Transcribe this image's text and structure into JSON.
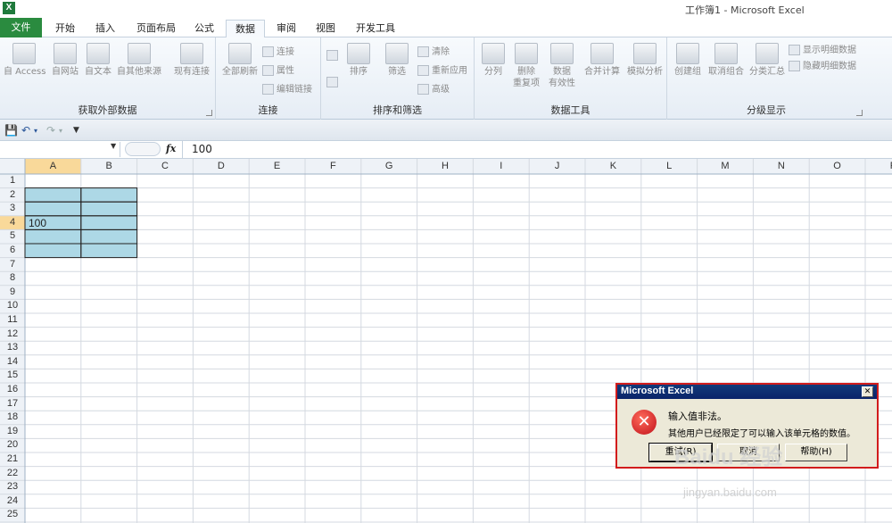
{
  "window": {
    "title": "工作簿1 - Microsoft Excel",
    "app_icon": "X"
  },
  "tabs": [
    {
      "label": "文件"
    },
    {
      "label": "开始"
    },
    {
      "label": "插入"
    },
    {
      "label": "页面布局"
    },
    {
      "label": "公式"
    },
    {
      "label": "数据"
    },
    {
      "label": "审阅"
    },
    {
      "label": "视图"
    },
    {
      "label": "开发工具"
    }
  ],
  "active_tab": "数据",
  "ribbon": {
    "groups": [
      {
        "label": "获取外部数据",
        "buttons": [
          "自 Access",
          "自网站",
          "自文本",
          "自其他来源",
          "现有连接"
        ]
      },
      {
        "label": "连接",
        "buttons": [
          "全部刷新",
          "连接",
          "属性",
          "编辑链接"
        ]
      },
      {
        "label": "排序和筛选",
        "buttons": [
          "排序",
          "筛选",
          "清除",
          "重新应用",
          "高级"
        ]
      },
      {
        "label": "数据工具",
        "buttons": [
          "分列",
          "删除",
          "重复项",
          "数据",
          "有效性",
          "合并计算",
          "模拟分析"
        ]
      },
      {
        "label": "分级显示",
        "buttons": [
          "创建组",
          "取消组合",
          "分类汇总",
          "显示明细数据",
          "隐藏明细数据"
        ]
      }
    ]
  },
  "formula_bar": {
    "name_box": "",
    "fx": "fx",
    "value": "100"
  },
  "columns": [
    "A",
    "B",
    "C",
    "D",
    "E",
    "F",
    "G",
    "H",
    "I",
    "J",
    "K",
    "L",
    "M",
    "N",
    "O",
    "P"
  ],
  "rows": [
    "1",
    "2",
    "3",
    "4",
    "5",
    "6",
    "7",
    "8",
    "9",
    "10",
    "11",
    "12",
    "13",
    "14",
    "15",
    "16",
    "17",
    "18",
    "19",
    "20",
    "21",
    "22",
    "23",
    "24",
    "25"
  ],
  "cells": {
    "A4": "100"
  },
  "dialog": {
    "title": "Microsoft Excel",
    "message": "输入值非法。",
    "detail": "其他用户已经限定了可以输入该单元格的数值。",
    "buttons": [
      "重试(R)",
      "取消",
      "帮助(H)"
    ]
  },
  "watermark": {
    "main": "Baidu 经验",
    "sub": "jingyan.baidu.com"
  },
  "colors": {
    "file_tab": "#2a8b3f",
    "selection_fill": "#add8e6",
    "dialog_border": "#d21c1c",
    "dialog_title": "#0a246a"
  }
}
